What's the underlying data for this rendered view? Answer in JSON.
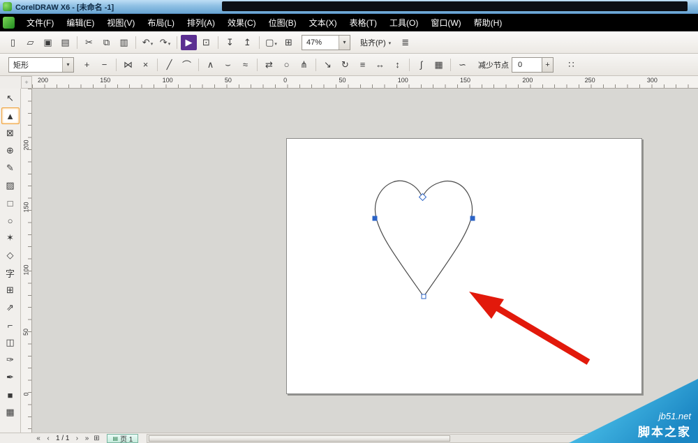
{
  "window": {
    "title": "CorelDRAW X6 - [未命名 -1]"
  },
  "menu": {
    "items": [
      {
        "name": "menu-file",
        "label": "文件(F)"
      },
      {
        "name": "menu-edit",
        "label": "编辑(E)"
      },
      {
        "name": "menu-view",
        "label": "视图(V)"
      },
      {
        "name": "menu-layout",
        "label": "布局(L)"
      },
      {
        "name": "menu-arrange",
        "label": "排列(A)"
      },
      {
        "name": "menu-effects",
        "label": "效果(C)"
      },
      {
        "name": "menu-bitmaps",
        "label": "位图(B)"
      },
      {
        "name": "menu-text",
        "label": "文本(X)"
      },
      {
        "name": "menu-table",
        "label": "表格(T)"
      },
      {
        "name": "menu-tools",
        "label": "工具(O)"
      },
      {
        "name": "menu-window",
        "label": "窗口(W)"
      },
      {
        "name": "menu-help",
        "label": "帮助(H)"
      }
    ]
  },
  "standard_toolbar": {
    "icons": [
      {
        "name": "new-document-icon",
        "glyph": "▯"
      },
      {
        "name": "open-icon",
        "glyph": "▱"
      },
      {
        "name": "save-icon",
        "glyph": "▣"
      },
      {
        "name": "print-icon",
        "glyph": "▤"
      },
      {
        "name": "separator",
        "cls": "sep"
      },
      {
        "name": "cut-icon",
        "glyph": "✂"
      },
      {
        "name": "copy-icon",
        "glyph": "⧉"
      },
      {
        "name": "paste-icon",
        "glyph": "▥"
      },
      {
        "name": "separator",
        "cls": "sep"
      },
      {
        "name": "undo-icon",
        "glyph": "↶",
        "dropdown": true
      },
      {
        "name": "redo-icon",
        "glyph": "↷",
        "dropdown": true
      },
      {
        "name": "separator",
        "cls": "sep"
      },
      {
        "name": "app-launcher-icon",
        "glyph": "▶",
        "cls": "accent-purple"
      },
      {
        "name": "welcome-screen-icon",
        "glyph": "⊡"
      },
      {
        "name": "separator",
        "cls": "sep"
      },
      {
        "name": "import-icon",
        "glyph": "↧"
      },
      {
        "name": "export-icon",
        "glyph": "↥"
      },
      {
        "name": "separator",
        "cls": "sep"
      },
      {
        "name": "fullscreen-preview-icon",
        "glyph": "▢",
        "dropdown": true
      },
      {
        "name": "view-navigator-icon",
        "glyph": "⊞"
      }
    ],
    "zoom": {
      "value": "47%"
    },
    "snap": {
      "label": "贴齐(P)"
    },
    "options_glyph": "≣"
  },
  "property_bar": {
    "preset": {
      "value": "矩形"
    },
    "icons": [
      {
        "name": "add-node-icon",
        "glyph": "+"
      },
      {
        "name": "delete-node-icon",
        "glyph": "−"
      },
      {
        "name": "separator",
        "cls": "sep"
      },
      {
        "name": "join-nodes-icon",
        "glyph": "⋈"
      },
      {
        "name": "break-curve-icon",
        "glyph": "×"
      },
      {
        "name": "separator",
        "cls": "sep"
      },
      {
        "name": "convert-to-line-icon",
        "glyph": "╱"
      },
      {
        "name": "convert-to-curve-icon",
        "glyph": "⌒"
      },
      {
        "name": "separator",
        "cls": "sep"
      },
      {
        "name": "cusp-node-icon",
        "glyph": "∧"
      },
      {
        "name": "smooth-node-icon",
        "glyph": "⌣"
      },
      {
        "name": "symmetrical-node-icon",
        "glyph": "≈"
      },
      {
        "name": "separator",
        "cls": "sep"
      },
      {
        "name": "reverse-direction-icon",
        "glyph": "⇄"
      },
      {
        "name": "close-curve-icon",
        "glyph": "○"
      },
      {
        "name": "extract-subpath-icon",
        "glyph": "⋔"
      },
      {
        "name": "separator",
        "cls": "sep"
      },
      {
        "name": "stretch-nodes-icon",
        "glyph": "↘"
      },
      {
        "name": "rotate-nodes-icon",
        "glyph": "↻"
      },
      {
        "name": "align-nodes-icon",
        "glyph": "≡"
      },
      {
        "name": "reflect-horizontal-icon",
        "glyph": "↔"
      },
      {
        "name": "reflect-vertical-icon",
        "glyph": "↕"
      },
      {
        "name": "separator",
        "cls": "sep"
      },
      {
        "name": "elastic-mode-icon",
        "glyph": "∫"
      },
      {
        "name": "select-all-nodes-icon",
        "glyph": "▦"
      },
      {
        "name": "separator",
        "cls": "sep"
      },
      {
        "name": "curve-smoothness-icon",
        "glyph": "∽"
      }
    ],
    "reduce_nodes": {
      "label": "减少节点",
      "value": "0"
    },
    "stepper_glyph": "+",
    "trailing_icon_glyph": "∷"
  },
  "rulers": {
    "corner_glyph": "+",
    "horizontal": [
      "200",
      "150",
      "100",
      "50",
      "0",
      "50",
      "100",
      "150",
      "200",
      "250",
      "300"
    ],
    "vertical": [
      "200",
      "150",
      "100",
      "50",
      "0"
    ]
  },
  "toolbox": {
    "tools": [
      {
        "name": "pick-tool",
        "glyph": "↖"
      },
      {
        "name": "shape-tool",
        "glyph": "▲",
        "selected": true
      },
      {
        "name": "crop-tool",
        "glyph": "⊠"
      },
      {
        "name": "zoom-tool",
        "glyph": "⊕"
      },
      {
        "name": "freehand-tool",
        "glyph": "✎"
      },
      {
        "name": "smart-fill-tool",
        "glyph": "▨"
      },
      {
        "name": "rectangle-tool",
        "glyph": "□"
      },
      {
        "name": "ellipse-tool",
        "glyph": "○"
      },
      {
        "name": "polygon-tool",
        "glyph": "✶"
      },
      {
        "name": "basic-shapes-tool",
        "glyph": "◇"
      },
      {
        "name": "text-tool",
        "glyph": "字"
      },
      {
        "name": "table-tool",
        "glyph": "⊞"
      },
      {
        "name": "dimension-tool",
        "glyph": "⇗"
      },
      {
        "name": "connector-tool",
        "glyph": "⌐"
      },
      {
        "name": "blend-tool",
        "glyph": "◫"
      },
      {
        "name": "eyedropper-tool",
        "glyph": "✑"
      },
      {
        "name": "outline-pen-tool",
        "glyph": "✒"
      },
      {
        "name": "fill-tool",
        "glyph": "■"
      },
      {
        "name": "interactive-fill-tool",
        "glyph": "▦"
      }
    ]
  },
  "statusbar": {
    "nav": {
      "first": "«",
      "prev": "‹",
      "next": "›",
      "last": "»"
    },
    "page_indicator": "1 / 1",
    "add_page_glyph": "⊞",
    "tab_icon_glyph": "▤",
    "page_tab_label": "页 1"
  },
  "watermark": {
    "site": "jb51.net",
    "brand": "脚本之家"
  },
  "colors": {
    "arrow_red": "#e2190b",
    "node_blue": "#2b63c6",
    "watermark_top": "#55cdf2",
    "watermark_bottom": "#1b86c3"
  }
}
